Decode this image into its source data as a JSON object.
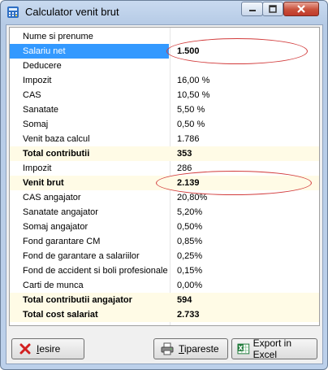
{
  "window": {
    "title": "Calculator venit brut"
  },
  "rows": [
    {
      "label": "Nume si prenume",
      "value": ""
    },
    {
      "label": "Salariu net",
      "value": "1.500"
    },
    {
      "label": "Deducere",
      "value": ""
    },
    {
      "label": "Impozit",
      "value": "16,00 %"
    },
    {
      "label": "CAS",
      "value": "10,50 %"
    },
    {
      "label": "Sanatate",
      "value": "5,50 %"
    },
    {
      "label": "Somaj",
      "value": "0,50 %"
    },
    {
      "label": "Venit baza calcul",
      "value": "1.786"
    },
    {
      "label": "Total contributii",
      "value": "353"
    },
    {
      "label": "Impozit",
      "value": "286"
    },
    {
      "label": "Venit brut",
      "value": "2.139"
    },
    {
      "label": "CAS angajator",
      "value": "20,80%"
    },
    {
      "label": "Sanatate angajator",
      "value": "5,20%"
    },
    {
      "label": "Somaj angajator",
      "value": "0,50%"
    },
    {
      "label": "Fond garantare CM",
      "value": "0,85%"
    },
    {
      "label": "Fond de garantare a salariilor",
      "value": "0,25%"
    },
    {
      "label": "Fond de accident si boli profesionale",
      "value": "0,15%"
    },
    {
      "label": "Carti de munca",
      "value": "0,00%"
    },
    {
      "label": "Total contributii angajator",
      "value": "594"
    },
    {
      "label": "Total cost salariat",
      "value": "2.733"
    }
  ],
  "buttons": {
    "iesire_first": "I",
    "iesire_rest": "esire",
    "tiparest_first": "T",
    "tiparest_rest": "ipareste",
    "excel": "Export in Excel"
  },
  "colors": {
    "selection": "#3399ff",
    "total_row_bg": "#fffbe6",
    "highlight_oval": "#d23b3b"
  }
}
